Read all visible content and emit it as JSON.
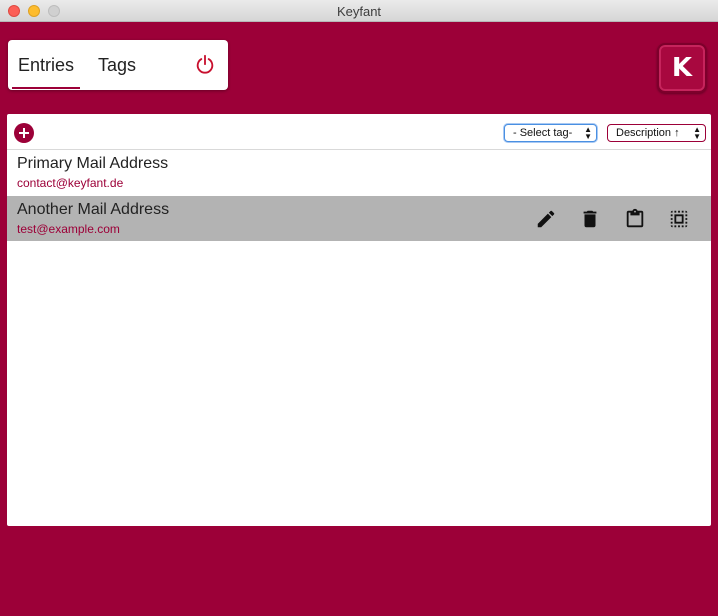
{
  "window": {
    "title": "Keyfant"
  },
  "nav": {
    "tabs": [
      {
        "label": "Entries",
        "active": true
      },
      {
        "label": "Tags",
        "active": false
      }
    ],
    "power_icon": "power-icon"
  },
  "logo": {
    "icon": "keyfant-logo",
    "letter": "K"
  },
  "toolbar": {
    "add_icon": "add-icon",
    "tag_filter": {
      "selected": "- Select tag-"
    },
    "sort": {
      "selected": "Description ↑"
    }
  },
  "entries": [
    {
      "title": "Primary Mail Address",
      "email": "contact@keyfant.de",
      "selected": false
    },
    {
      "title": "Another Mail Address",
      "email": "test@example.com",
      "selected": true
    }
  ],
  "entry_actions": [
    "edit-icon",
    "delete-icon",
    "clipboard-icon",
    "copy-icon"
  ],
  "colors": {
    "brand": "#9c0038",
    "selected_row": "#b3b3b3"
  }
}
